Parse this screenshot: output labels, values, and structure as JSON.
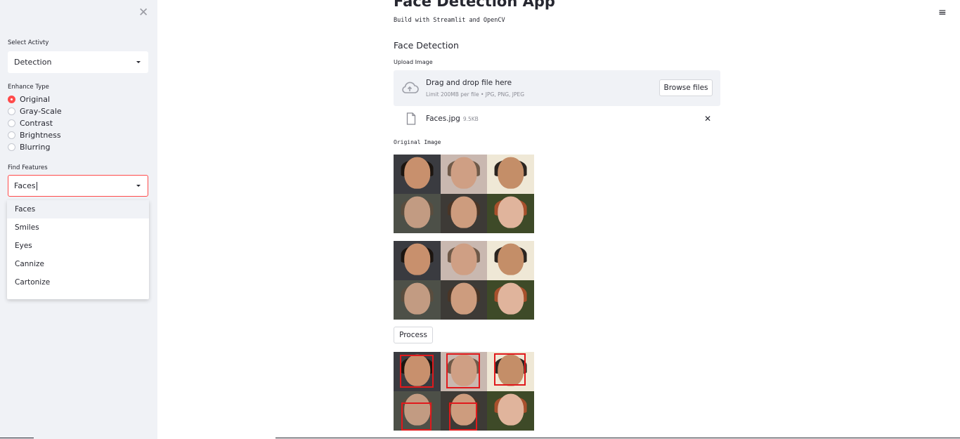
{
  "sidebar": {
    "close_icon": "close-icon",
    "select_activity_label": "Select Activty",
    "select_activity_value": "Detection",
    "enhance_type_label": "Enhance Type",
    "enhance_options": [
      {
        "label": "Original",
        "selected": true
      },
      {
        "label": "Gray-Scale",
        "selected": false
      },
      {
        "label": "Contrast",
        "selected": false
      },
      {
        "label": "Brightness",
        "selected": false
      },
      {
        "label": "Blurring",
        "selected": false
      }
    ],
    "find_features_label": "Find Features",
    "find_features_value": "Faces",
    "dropdown_options": [
      "Faces",
      "Smiles",
      "Eyes",
      "Cannize",
      "Cartonize"
    ]
  },
  "header": {
    "menu_icon": "hamburger-menu-icon"
  },
  "main": {
    "title": "Face Detection App",
    "subtitle": "Build with Streamlit and OpenCV",
    "section_title": "Face Detection",
    "upload_label": "Upload Image",
    "uploader": {
      "drag_text": "Drag and drop file here",
      "limit_text": "Limit 200MB per file • JPG, PNG, JPEG",
      "browse_label": "Browse files"
    },
    "file": {
      "name": "Faces.jpg",
      "size": "9.5KB"
    },
    "original_image_label": "Original Image",
    "process_label": "Process"
  },
  "colors": {
    "accent": "#ff4b4b",
    "sidebar_bg": "#f0f2f6",
    "box": "#e0191c"
  }
}
